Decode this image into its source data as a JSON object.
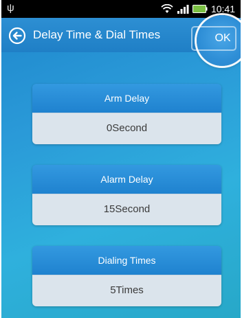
{
  "status_bar": {
    "time": "10:41",
    "icons": [
      "usb-icon",
      "wifi-icon",
      "signal-icon",
      "battery-icon"
    ]
  },
  "header": {
    "title": "Delay Time & Dial Times",
    "ok_label": "OK"
  },
  "settings": [
    {
      "label": "Arm Delay",
      "value": "0Second"
    },
    {
      "label": "Alarm Delay",
      "value": "15Second"
    },
    {
      "label": "Dialing Times",
      "value": "5Times"
    }
  ],
  "colors": {
    "background_gradient_start": "#1e86cc",
    "background_gradient_end": "#2fb0dd",
    "header_blue": "#2d8fd3",
    "value_field": "#dbe4ec",
    "value_text": "#3a3a3a"
  }
}
